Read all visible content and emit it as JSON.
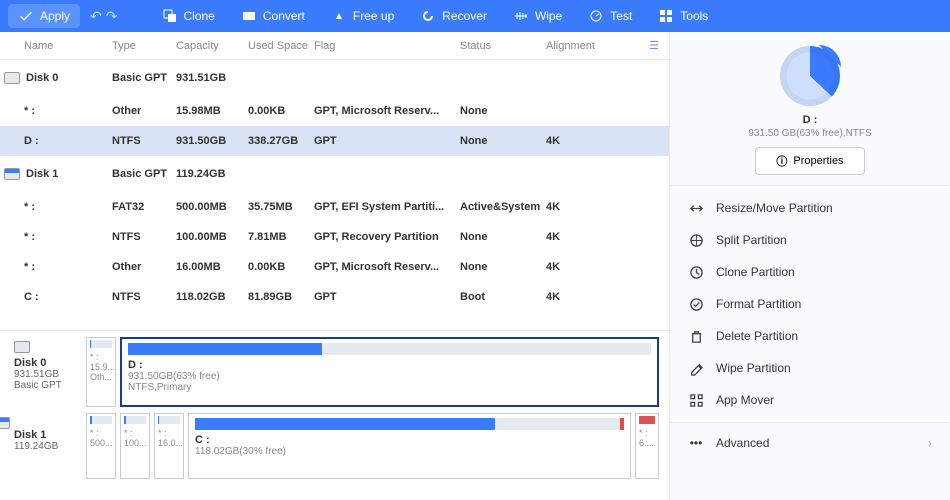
{
  "toolbar": {
    "apply": "Apply",
    "items": [
      "Clone",
      "Convert",
      "Free up",
      "Recover",
      "Wipe",
      "Test",
      "Tools"
    ]
  },
  "columns": [
    "Name",
    "Type",
    "Capacity",
    "Used Space",
    "Flag",
    "Status",
    "Alignment"
  ],
  "rows": [
    {
      "kind": "disk",
      "icon": "plain",
      "name": "Disk 0",
      "type": "Basic GPT",
      "cap": "931.51GB",
      "used": "",
      "flag": "",
      "stat": "",
      "align": ""
    },
    {
      "kind": "part",
      "name": "* :",
      "type": "Other",
      "cap": "15.98MB",
      "used": "0.00KB",
      "flag": "GPT, Microsoft Reserv...",
      "stat": "None",
      "align": ""
    },
    {
      "kind": "part",
      "sel": true,
      "name": "D :",
      "type": "NTFS",
      "cap": "931.50GB",
      "used": "338.27GB",
      "flag": "GPT",
      "stat": "None",
      "align": "4K"
    },
    {
      "kind": "disk",
      "icon": "blue",
      "name": "Disk 1",
      "type": "Basic GPT",
      "cap": "119.24GB",
      "used": "",
      "flag": "",
      "stat": "",
      "align": ""
    },
    {
      "kind": "part",
      "name": "* :",
      "type": "FAT32",
      "cap": "500.00MB",
      "used": "35.75MB",
      "flag": "GPT, EFI System Partiti...",
      "stat": "Active&System",
      "align": "4K"
    },
    {
      "kind": "part",
      "name": "* :",
      "type": "NTFS",
      "cap": "100.00MB",
      "used": "7.81MB",
      "flag": "GPT, Recovery Partition",
      "stat": "None",
      "align": "4K"
    },
    {
      "kind": "part",
      "name": "* :",
      "type": "Other",
      "cap": "16.00MB",
      "used": "0.00KB",
      "flag": "GPT, Microsoft Reserv...",
      "stat": "None",
      "align": "4K"
    },
    {
      "kind": "part",
      "name": "C :",
      "type": "NTFS",
      "cap": "118.02GB",
      "used": "81.89GB",
      "flag": "GPT",
      "stat": "Boot",
      "align": "4K"
    }
  ],
  "diagram": {
    "d0": {
      "name": "Disk 0",
      "size": "931.51GB",
      "type": "Basic GPT",
      "p0": {
        "n": "* :",
        "s": "15.9...",
        "t": "Oth..."
      },
      "big": {
        "n": "D :",
        "s": "931.50GB(63% free)",
        "t": "NTFS,Primary",
        "fill": 37
      }
    },
    "d1": {
      "name": "Disk 1",
      "size": "119.24GB",
      "minis": [
        {
          "n": "* :",
          "s": "500..."
        },
        {
          "n": "* :",
          "s": "100..."
        },
        {
          "n": "* :",
          "s": "16.0..."
        }
      ],
      "big": {
        "n": "C :",
        "s": "118.02GB(30% free)",
        "fill": 70
      },
      "tail": {
        "n": "* :",
        "s": "6...."
      }
    }
  },
  "side": {
    "drive": "D :",
    "detail": "931.50 GB(63% free),NTFS",
    "properties": "Properties",
    "ops": [
      "Resize/Move Partition",
      "Split Partition",
      "Clone Partition",
      "Format Partition",
      "Delete Partition",
      "Wipe Partition",
      "App Mover"
    ],
    "advanced": "Advanced"
  }
}
